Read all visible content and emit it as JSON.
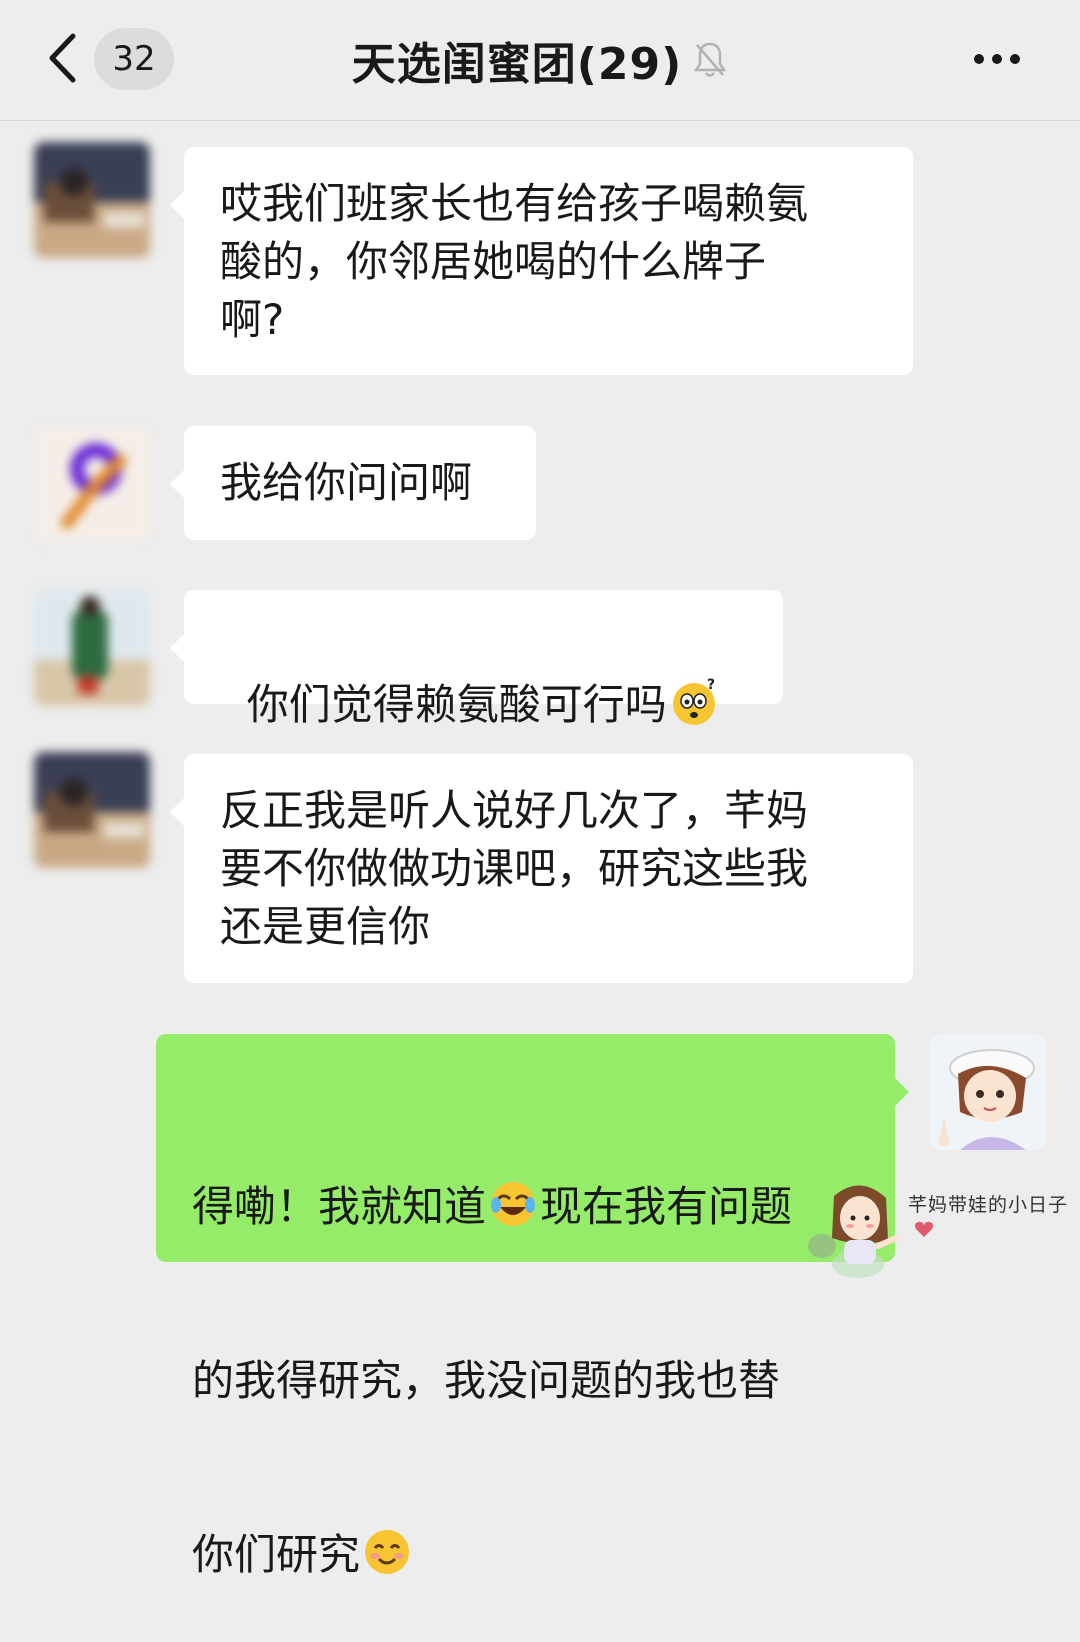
{
  "header": {
    "back_icon": "chevron-left-icon",
    "unread_count": "32",
    "title": "天选闺蜜团(29)",
    "mute_icon": "bell-muted-icon",
    "more_icon": "more-dots-icon"
  },
  "messages": [
    {
      "sender": "other",
      "text": "哎我们班家长也有给孩子喝赖氨\n酸的，你邻居她喝的什么牌子\n啊?"
    },
    {
      "sender": "other",
      "text": "我给你问问啊"
    },
    {
      "sender": "other",
      "text_before_emoji": "你们觉得赖氨酸可行吗",
      "emoji": "confused-face-emoji"
    },
    {
      "sender": "other",
      "text": "反正我是听人说好几次了，芊妈\n要不你做做功课吧，研究这些我\n还是更信你"
    },
    {
      "sender": "me",
      "line1_a": "得嘞！我就知道",
      "emoji1": "laughing-tears-emoji",
      "line1_b": "现在我有问题",
      "line2": "的我得研究，我没问题的我也替",
      "line3": "你们研究",
      "emoji2": "smiling-face-emoji"
    }
  ],
  "watermark": {
    "text": "芊妈带娃的小日子",
    "icon": "heart-icon"
  },
  "colors": {
    "background": "#ededed",
    "bubble_other": "#ffffff",
    "bubble_me": "#95ec69"
  }
}
